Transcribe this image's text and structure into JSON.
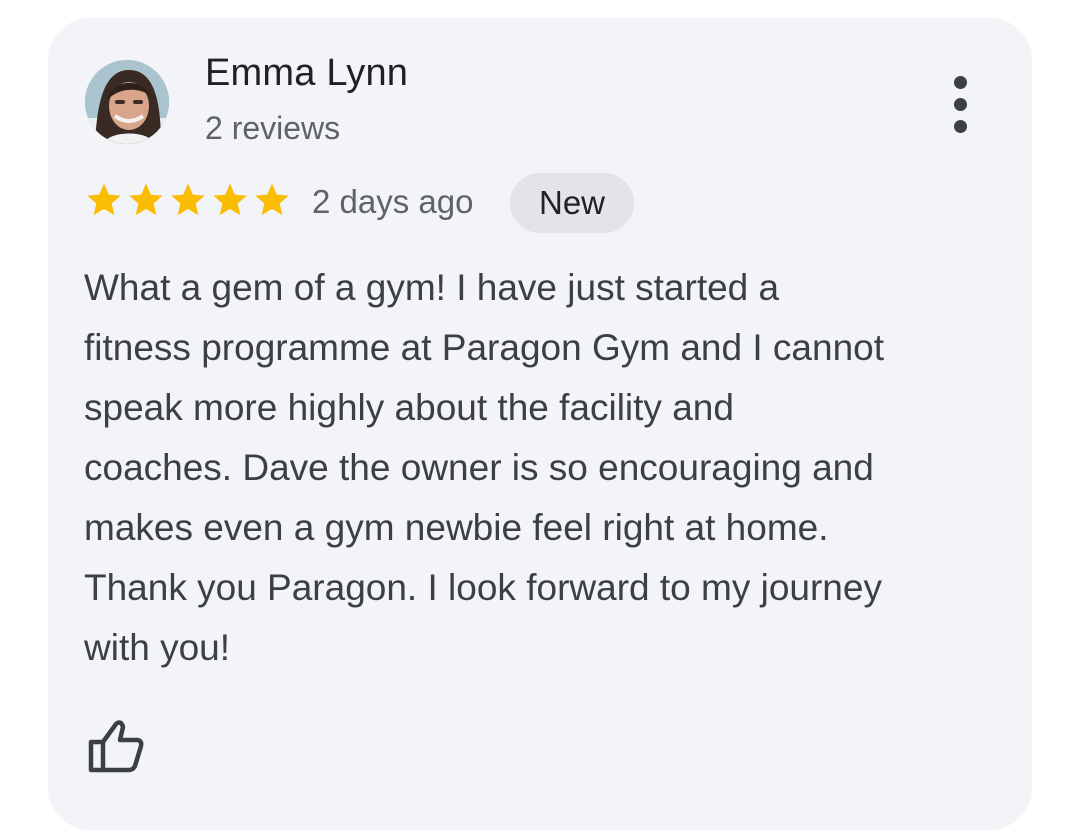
{
  "review": {
    "author_name": "Emma Lynn",
    "author_reviews": "2 reviews",
    "rating": 5,
    "rating_max": 5,
    "date": "2 days ago",
    "badge": "New",
    "text_lines": [
      "What a gem of a gym! I have just started a",
      "fitness programme at Paragon Gym and I cannot",
      "speak more highly about the facility and",
      "coaches. Dave the owner is so encouraging and",
      "makes even a gym newbie feel right at home.",
      "Thank you Paragon. I look forward to my journey",
      "with you!"
    ]
  },
  "icons": {
    "avatar": "avatar",
    "more": "more-vert-icon",
    "star": "star-icon",
    "like": "thumb-up-icon"
  },
  "colors": {
    "card_background": "#f3f4f7",
    "star_fill": "#fbbc04",
    "badge_background": "#e3e4e8",
    "primary_text": "#202124",
    "secondary_text": "#5f6368"
  }
}
